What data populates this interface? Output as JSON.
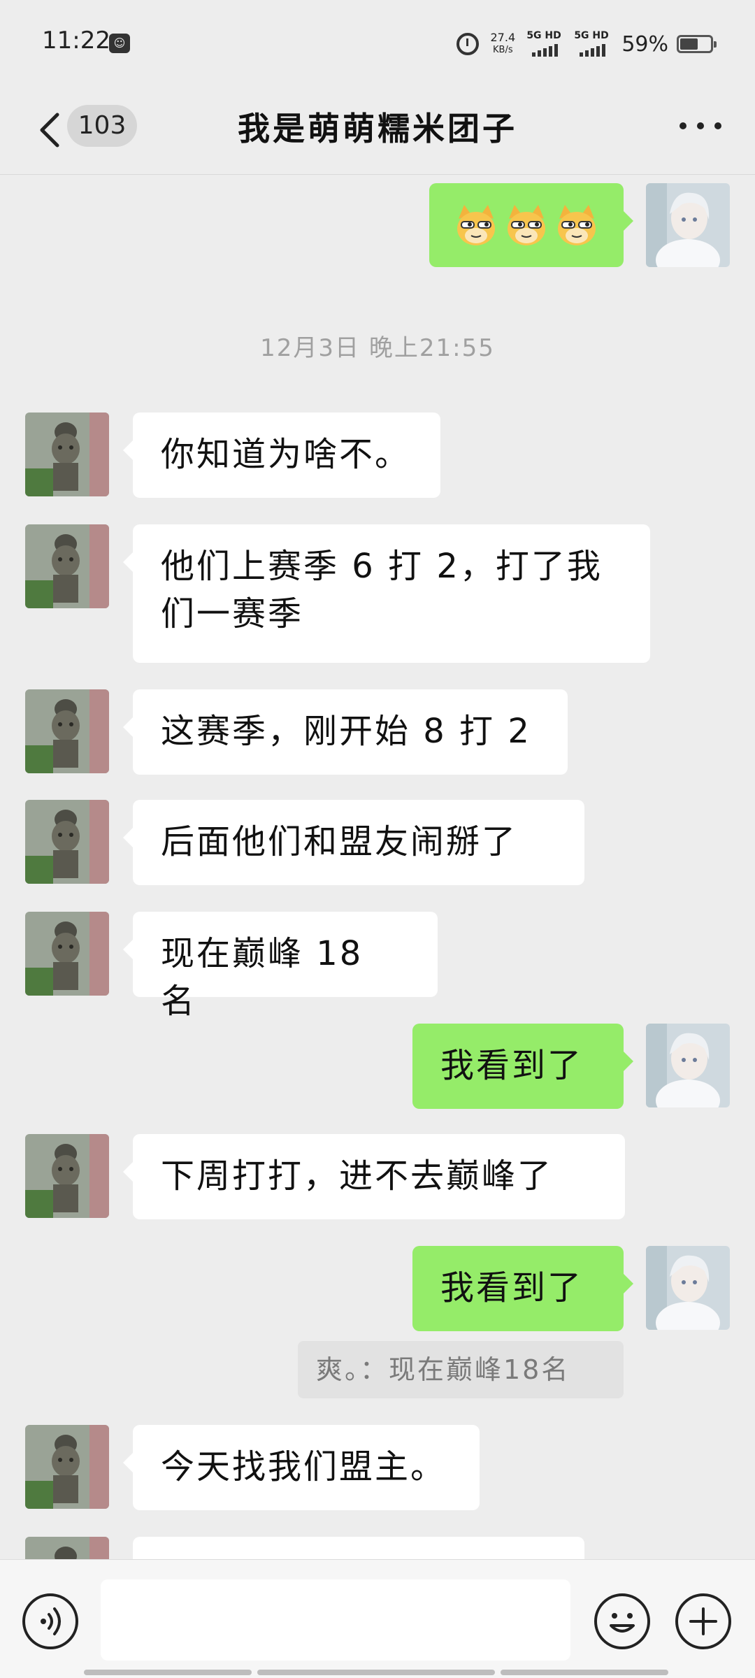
{
  "status_bar": {
    "time": "11:22",
    "speed_value": "27.4",
    "speed_unit": "KB/s",
    "sim1": "5G HD",
    "sim2": "5G HD",
    "battery_percent": "59%",
    "battery_level": 0.59
  },
  "header": {
    "unread_count": "103",
    "title": "我是萌萌糯米团子"
  },
  "timestamp": "12月3日 晚上21:55",
  "messages": [
    {
      "side": "right",
      "type": "emoji",
      "icon": "doge-cat-emoji x3"
    },
    {
      "side": "left",
      "text": "你知道为啥不。"
    },
    {
      "side": "left",
      "line1": "他们上赛季 6 打 2，打了我",
      "line2": "们一赛季"
    },
    {
      "side": "left",
      "text": "这赛季，刚开始 8 打 2"
    },
    {
      "side": "left",
      "text": "后面他们和盟友闹掰了"
    },
    {
      "side": "left",
      "text": "现在巅峰 18 名"
    },
    {
      "side": "right",
      "text": "我看到了"
    },
    {
      "side": "left",
      "text": "下周打打，进不去巅峰了"
    },
    {
      "side": "right",
      "text": "我看到了"
    },
    {
      "side": "left",
      "text": "今天找我们盟主。"
    }
  ],
  "quote": "爽。：现在巅峰18名",
  "colors": {
    "background": "#ededed",
    "green_bubble": "#95ec69",
    "white_bubble": "#ffffff",
    "timestamp_text": "#a0a0a0"
  },
  "input_bar": {
    "voice_icon": "voice-icon",
    "emoji_icon": "smiley-icon",
    "plus_icon": "plus-icon"
  }
}
